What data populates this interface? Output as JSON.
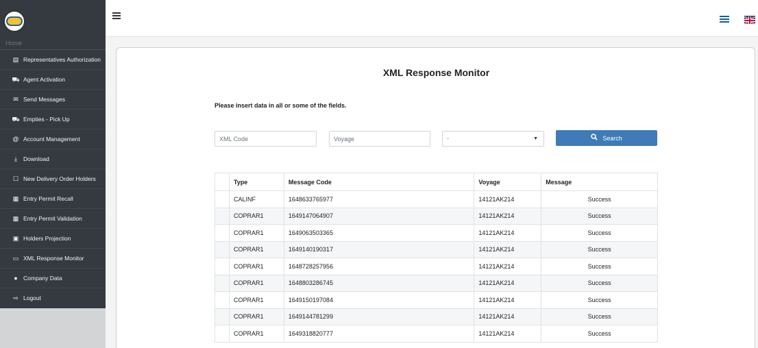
{
  "sidebar": {
    "home_label": "Home",
    "items": [
      {
        "label": "Representatives Authorization",
        "icon": "id-card-icon"
      },
      {
        "label": "Agent Activation",
        "icon": "truck-icon"
      },
      {
        "label": "Send Messages",
        "icon": "envelope-icon"
      },
      {
        "label": "Empties - Pick Up",
        "icon": "truck-icon"
      },
      {
        "label": "Account Management",
        "icon": "at-icon"
      },
      {
        "label": "Download",
        "icon": "download-icon"
      },
      {
        "label": "New Delivery Order Holders",
        "icon": "square-icon"
      },
      {
        "label": "Entry Permit Recall",
        "icon": "calendar-x-icon"
      },
      {
        "label": "Entry Permit Validation",
        "icon": "calendar-check-icon"
      },
      {
        "label": "Holders Projection",
        "icon": "h-square-icon"
      },
      {
        "label": "XML Response Monitor",
        "icon": "desktop-icon"
      },
      {
        "label": "Company Data",
        "icon": "info-circle-icon"
      },
      {
        "label": "Logout",
        "icon": "logout-icon"
      }
    ]
  },
  "topbar": {
    "menu_icon": "hamburger-icon",
    "languages": [
      "gr-flag-icon",
      "uk-flag-icon"
    ]
  },
  "main": {
    "title": "XML Response Monitor",
    "instructions": "Please insert data in all or some of the fields.",
    "xml_code_placeholder": "XML Code",
    "voyage_placeholder": "Voyage",
    "select_value": "-",
    "search_label": "Search",
    "accent_color": "#3e7bb7"
  },
  "table": {
    "headers": [
      "Type",
      "Message Code",
      "Voyage",
      "Message"
    ],
    "rows": [
      [
        "CALINF",
        "1648633765977",
        "14121AK214",
        "Success"
      ],
      [
        "COPRAR1",
        "1649147064907",
        "14121AK214",
        "Success"
      ],
      [
        "COPRAR1",
        "1649063503365",
        "14121AK214",
        "Success"
      ],
      [
        "COPRAR1",
        "1649140190317",
        "14121AK214",
        "Success"
      ],
      [
        "COPRAR1",
        "1648728257956",
        "14121AK214",
        "Success"
      ],
      [
        "COPRAR1",
        "1648803286745",
        "14121AK214",
        "Success"
      ],
      [
        "COPRAR1",
        "1649150197084",
        "14121AK214",
        "Success"
      ],
      [
        "COPRAR1",
        "1649144781299",
        "14121AK214",
        "Success"
      ],
      [
        "COPRAR1",
        "1649318820777",
        "14121AK214",
        "Success"
      ]
    ]
  }
}
